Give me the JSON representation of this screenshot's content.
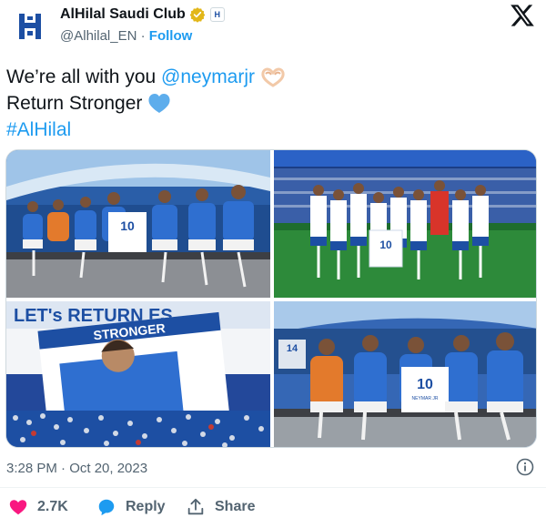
{
  "account": {
    "display_name": "AlHilal Saudi Club",
    "handle": "@Alhilal_EN",
    "separator": "·",
    "follow_label": "Follow"
  },
  "tweet": {
    "line1_prefix": "We’re all with you ",
    "mention": "@neymarjr",
    "line2": "Return Stronger",
    "hashtag": "#AlHilal"
  },
  "media": {
    "banner_text_top": "LET's RETURN ES",
    "banner_text_sub": "STRONGER",
    "shirt_number": "10",
    "shirt_name": "NEYMAR JR",
    "seat_number": "14"
  },
  "meta": {
    "timestamp": "3:28 PM · Oct 20, 2023"
  },
  "actions": {
    "like_count": "2.7K",
    "reply_label": "Reply",
    "share_label": "Share"
  },
  "colors": {
    "accent": "#1d9bf0",
    "like": "#f91880",
    "club_blue": "#1d4fa3"
  },
  "icons": [
    "club-logo-icon",
    "verified-badge-icon",
    "affiliate-badge-icon",
    "x-logo-icon",
    "heart-hands-emoji",
    "blue-heart-emoji",
    "info-icon",
    "heart-icon",
    "reply-bubble-icon",
    "share-icon"
  ]
}
